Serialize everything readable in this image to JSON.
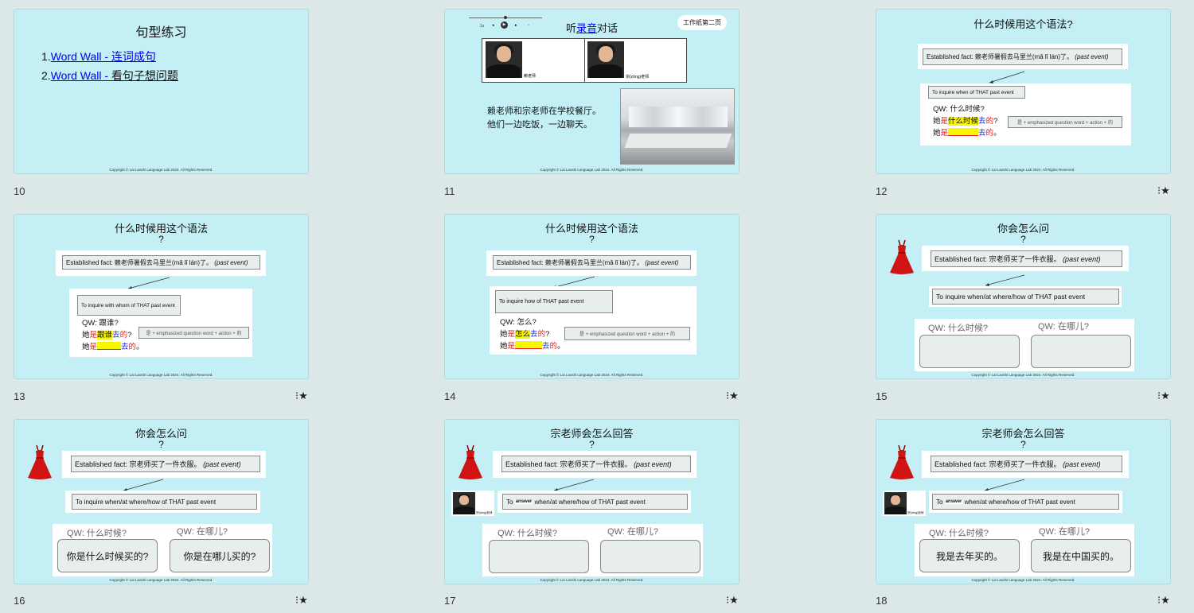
{
  "copyright": "Copyright © Lai Laoshi Language Lab 2024. All Rights Reserved.",
  "star": "⁝★",
  "slides": [
    {
      "num": "10",
      "title": "句型练习",
      "items": [
        {
          "n": "1.",
          "link": "Word Wall - 连词成句"
        },
        {
          "n": "2.",
          "link_a": "Word Wall - ",
          "rest": "看句子想问题"
        }
      ]
    },
    {
      "num": "11",
      "title_a": "听",
      "title_link": "录音",
      "title_b": "对话",
      "badge": "工作纸第二页",
      "person1": "赖老师",
      "person2": "宗(zōng)老师",
      "line1": "赖老师和宗老师在学校餐厅。",
      "line2": "他们一边吃饭，一边聊天。",
      "audio": {
        "speed": "1x",
        "progress": 0.5
      }
    },
    {
      "num": "12",
      "title": "什么时候用这个语法?",
      "fact": "Established fact: 赖老师暑假去马里兰(mǎ lǐ lán)了。",
      "past": "(past event)",
      "inquire": "To inquire when of THAT past event",
      "qw": "QW: 什么时候?",
      "s_a": "她",
      "s_shi": "是",
      "s_q": "什么时候",
      "s_v": "去",
      "s_de": "的",
      "s_end": "?",
      "t_end": "。",
      "hint": "是 + emphasized question word + action + 的"
    },
    {
      "num": "13",
      "title": "什么时候用这个语法",
      "q": "?",
      "fact": "Established fact: 赖老师暑假去马里兰(mǎ lǐ lán)了。",
      "past": "(past event)",
      "inquire": "To inquire with whom of THAT past event",
      "qw": "QW: 跟谁?",
      "s_a": "她",
      "s_shi": "是",
      "s_q": "跟谁",
      "s_v": "去",
      "s_de": "的",
      "s_end": "?",
      "t_end": "。",
      "hint": "是 + emphasized question word + action + 的"
    },
    {
      "num": "14",
      "title": "什么时候用这个语法",
      "q": "?",
      "fact": "Established fact: 赖老师暑假去马里兰(mǎ lǐ lán)了。",
      "past": "(past event)",
      "inquire": "To inquire how of THAT past event",
      "qw": "QW: 怎么?",
      "s_a": "她",
      "s_shi": "是",
      "s_q": "怎么",
      "s_v": "去",
      "s_de": "的",
      "s_end": "?",
      "t_end": "。",
      "hint": "是 + emphasized question word + action + 的"
    },
    {
      "num": "15",
      "title": "你会怎么问",
      "q": "?",
      "fact": "Established fact: 宗老师买了一件衣服。",
      "past": "(past event)",
      "inquire": "To inquire when/at where/how of THAT past event",
      "qw1": "QW: 什么时候?",
      "qw2": "QW: 在哪儿?",
      "a1": "",
      "a2": ""
    },
    {
      "num": "16",
      "title": "你会怎么问",
      "q": "?",
      "fact": "Established fact: 宗老师买了一件衣服。",
      "past": "(past event)",
      "inquire": "To inquire when/at where/how of THAT past event",
      "qw1": "QW: 什么时候?",
      "qw2": "QW: 在哪儿?",
      "a1": "你是什么时候买的?",
      "a2": "你是在哪儿买的?"
    },
    {
      "num": "17",
      "title": "宗老师会怎么回答",
      "q": "?",
      "fact": "Established fact: 宗老师买了一件衣服。",
      "past": "(past event)",
      "to": "To",
      "answer": "answer",
      "inquire_rest": "when/at where/how of THAT past event",
      "person": "宗(zōng)老师",
      "qw1": "QW: 什么时候?",
      "qw2": "QW: 在哪儿?",
      "a1": "",
      "a2": ""
    },
    {
      "num": "18",
      "title": "宗老师会怎么回答",
      "q": "?",
      "fact": "Established fact: 宗老师买了一件衣服。",
      "past": "(past event)",
      "to": "To",
      "answer": "answer",
      "inquire_rest": "when/at where/how of THAT past event",
      "person": "宗(zōng)老师",
      "qw1": "QW: 什么时候?",
      "qw2": "QW: 在哪儿?",
      "a1": "我是去年买的。",
      "a2": "我是在中国买的。"
    }
  ]
}
